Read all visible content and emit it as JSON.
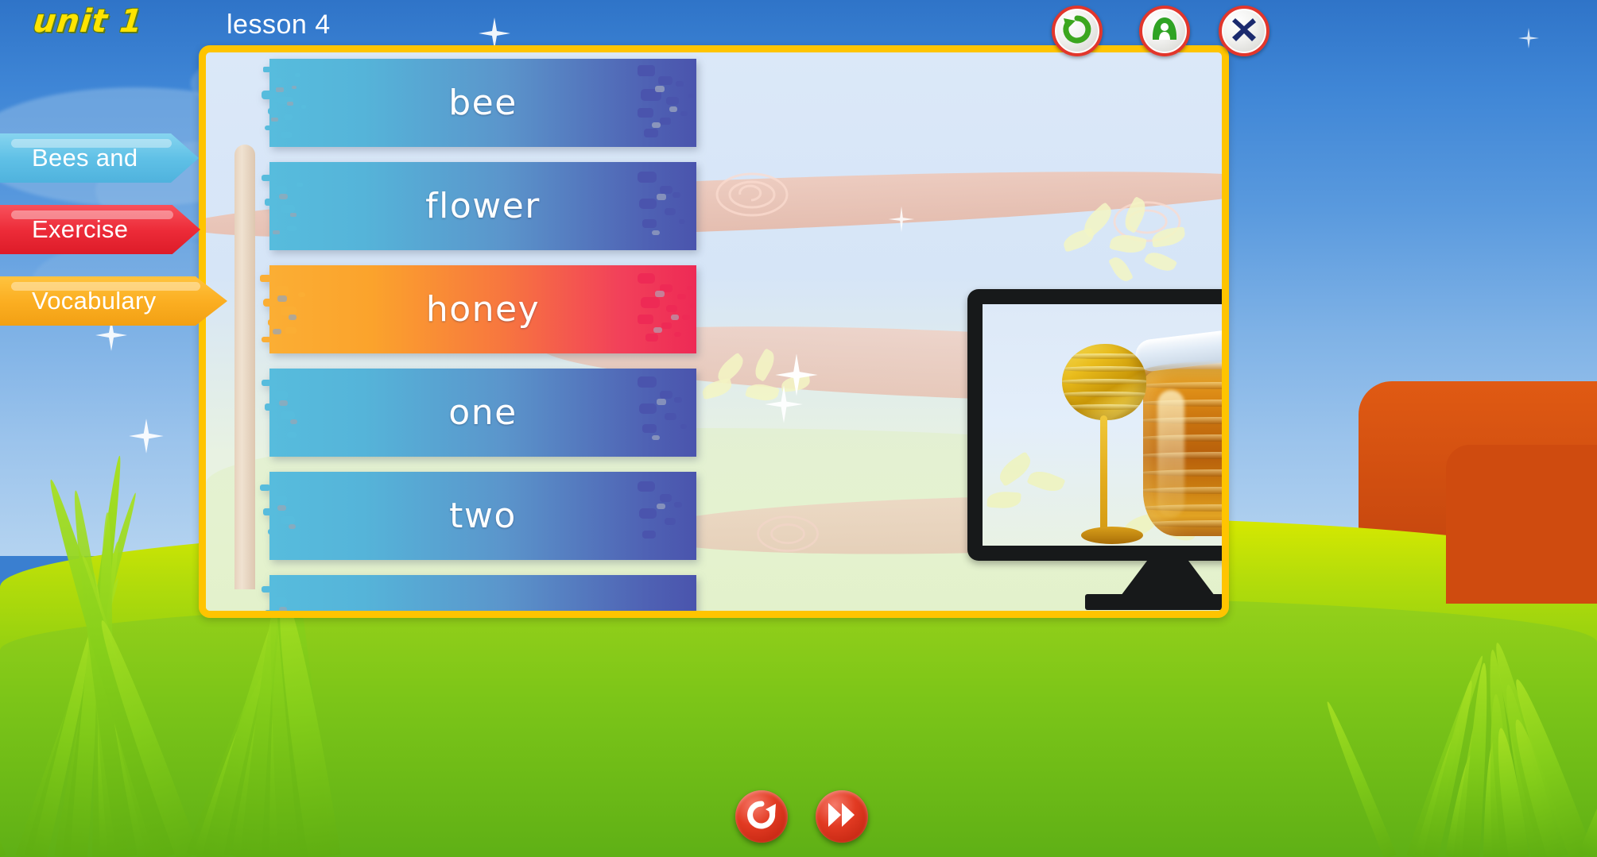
{
  "header": {
    "unit": "unit 1",
    "lesson": "lesson 4",
    "buttons": [
      {
        "name": "refresh-button",
        "icon": "refresh-icon",
        "label": "Refresh"
      },
      {
        "name": "home-button",
        "icon": "home-icon",
        "label": "Home"
      },
      {
        "name": "close-button",
        "icon": "close-icon",
        "label": "Close"
      }
    ]
  },
  "sidebar": {
    "items": [
      {
        "label": "Bees and",
        "color": "#5fc0e6",
        "state": "inactive"
      },
      {
        "label": "Exercise",
        "color": "#ec2b38",
        "state": "inactive"
      },
      {
        "label": "Vocabulary",
        "color": "#fbae21",
        "state": "active"
      }
    ]
  },
  "main": {
    "words": [
      {
        "label": "bee",
        "state": "normal",
        "color_start": "#57bcdd",
        "color_end": "#4a54ad"
      },
      {
        "label": "flower",
        "state": "normal",
        "color_start": "#57bcdd",
        "color_end": "#4a54ad"
      },
      {
        "label": "honey",
        "state": "selected",
        "color_start": "#fbae34",
        "color_end": "#ee2a55"
      },
      {
        "label": "one",
        "state": "normal",
        "color_start": "#57bcdd",
        "color_end": "#4a54ad"
      },
      {
        "label": "two",
        "state": "normal",
        "color_start": "#57bcdd",
        "color_end": "#4a54ad"
      },
      {
        "label": "",
        "state": "partial",
        "color_start": "#57bcdd",
        "color_end": "#4a54ad"
      }
    ],
    "media": {
      "name": "monitor-display",
      "image_subject": "honey jar with dipper",
      "alt": "Glass honey jar with honey dipper drizzling honey"
    }
  },
  "footer": {
    "buttons": [
      {
        "name": "replay-button",
        "icon": "replay-icon",
        "label": "Replay"
      },
      {
        "name": "next-button",
        "icon": "fast-forward-icon",
        "label": "Next"
      }
    ]
  },
  "theme": {
    "panel_border": "#ffc400",
    "sky": "#3f86d6",
    "grass": "#86cf1a"
  }
}
